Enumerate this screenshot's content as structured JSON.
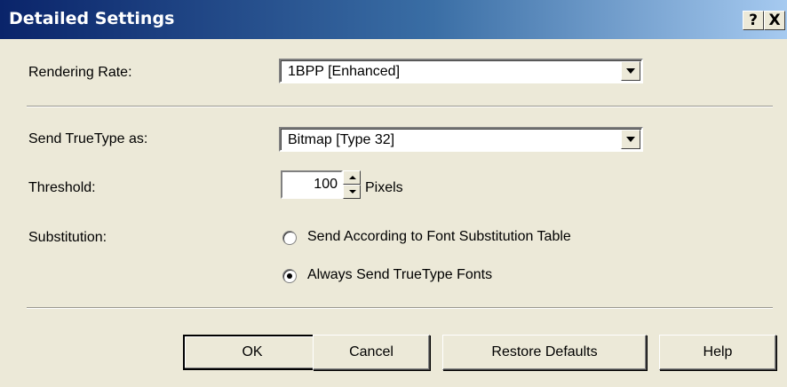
{
  "window": {
    "title": "Detailed Settings",
    "help_button": "?",
    "close_button": "X"
  },
  "rendering_rate": {
    "label": "Rendering Rate:",
    "value": "1BPP [Enhanced]"
  },
  "send_truetype": {
    "label": "Send TrueType as:",
    "value": "Bitmap [Type 32]"
  },
  "threshold": {
    "label": "Threshold:",
    "value": "100",
    "unit": "Pixels"
  },
  "substitution": {
    "label": "Substitution:",
    "options": [
      {
        "label": "Send According to Font Substitution Table",
        "selected": false
      },
      {
        "label": "Always Send TrueType Fonts",
        "selected": true
      }
    ]
  },
  "buttons": {
    "ok": "OK",
    "cancel": "Cancel",
    "restore_defaults": "Restore Defaults",
    "help": "Help"
  },
  "colors": {
    "titlebar_start": "#0a246a",
    "dialog_face": "#ece9d8"
  }
}
